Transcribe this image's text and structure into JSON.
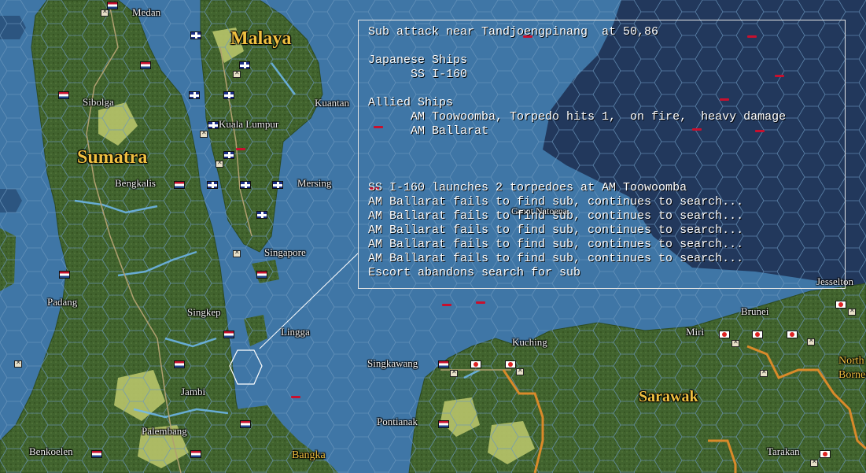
{
  "map": {
    "regions": [
      {
        "id": "malaya",
        "label": "Malaya"
      },
      {
        "id": "sumatra",
        "label": "Sumatra"
      },
      {
        "id": "sarawak",
        "label": "Sarawak"
      },
      {
        "id": "bangka",
        "label": "Bangka"
      },
      {
        "id": "north-borneo",
        "label": "North Borneo"
      }
    ],
    "places": [
      "Medan",
      "Sibolga",
      "Kuala Lumpur",
      "Kuantan",
      "Bengkalis",
      "Mersing",
      "Singapore",
      "Padang",
      "Singkep",
      "Lingga",
      "Jambi",
      "Palembang",
      "Benkoelen",
      "Pontianak",
      "Singkawang",
      "Kuching",
      "Miri",
      "Brunei",
      "Jesselton",
      "Tarakan",
      "Groot Natoena"
    ],
    "colors": {
      "sea": "#3f76a6",
      "deep_sea": "#22385c",
      "land": "#41632e",
      "clear_terrain": "#b8c46a",
      "river": "#6fb8f0",
      "road": "#b0a070",
      "border": "#d98a2a",
      "label": "#f0c040"
    }
  },
  "combat_report": {
    "title": "Sub attack near Tandjoengpinang  at 50,86",
    "lines": [
      "",
      "Japanese Ships",
      "      SS I-160",
      "",
      "Allied Ships",
      "      AM Toowoomba, Torpedo hits 1,  on fire,  heavy damage",
      "      AM Ballarat",
      "",
      "",
      "",
      "SS I-160 launches 2 torpedoes at AM Toowoomba",
      "AM Ballarat fails to find sub, continues to search...",
      "AM Ballarat fails to find sub, continues to search...",
      "AM Ballarat fails to find sub, continues to search...",
      "AM Ballarat fails to find sub, continues to search...",
      "AM Ballarat fails to find sub, continues to search...",
      "Escort abandons search for sub"
    ]
  }
}
